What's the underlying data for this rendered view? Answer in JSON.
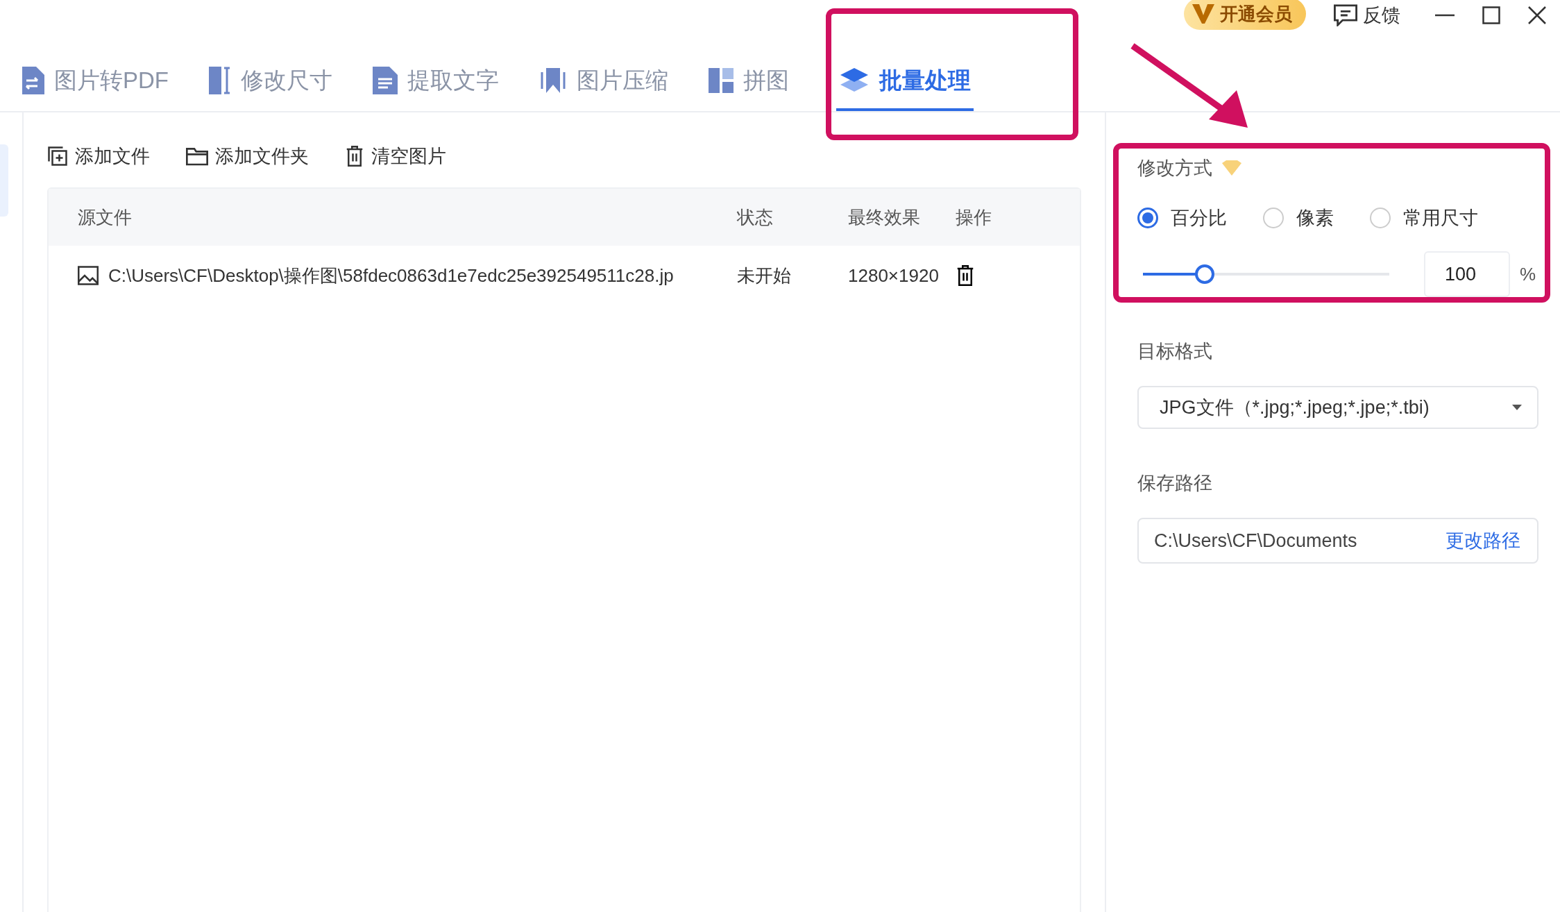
{
  "top_actions": {
    "vip": "开通会员",
    "feedback": "反馈"
  },
  "tabs": [
    {
      "label": "图片转PDF",
      "kind": "pdf",
      "selected": false
    },
    {
      "label": "修改尺寸",
      "kind": "resize",
      "selected": false
    },
    {
      "label": "提取文字",
      "kind": "text",
      "selected": false
    },
    {
      "label": "图片压缩",
      "kind": "compress",
      "selected": false
    },
    {
      "label": "拼图",
      "kind": "collage",
      "selected": false
    },
    {
      "label": "批量处理",
      "kind": "batch",
      "selected": true
    }
  ],
  "toolbar": [
    {
      "label": "添加文件",
      "kind": "add-file"
    },
    {
      "label": "添加文件夹",
      "kind": "add-folder"
    },
    {
      "label": "清空图片",
      "kind": "clear"
    }
  ],
  "table": {
    "columns": [
      "源文件",
      "状态",
      "最终效果",
      "操作"
    ],
    "rows": [
      {
        "source": "C:\\Users\\CF\\Desktop\\操作图\\58fdec0863d1e7edc25e392549511c28.jp",
        "status": "未开始",
        "result": "1280×1920"
      }
    ]
  },
  "resize": {
    "label": "修改方式",
    "options": [
      {
        "label": "百分比",
        "selected": true
      },
      {
        "label": "像素",
        "selected": false
      },
      {
        "label": "常用尺寸",
        "selected": false
      }
    ],
    "level": 0.25,
    "value": "100",
    "unit": "%"
  },
  "format": {
    "label": "目标格式",
    "value": "JPG文件（*.jpg;*.jpeg;*.jpe;*.tbi)"
  },
  "save_path": {
    "label": "保存路径",
    "value": "C:\\Users\\CF\\Documents",
    "action": "更改路径"
  }
}
